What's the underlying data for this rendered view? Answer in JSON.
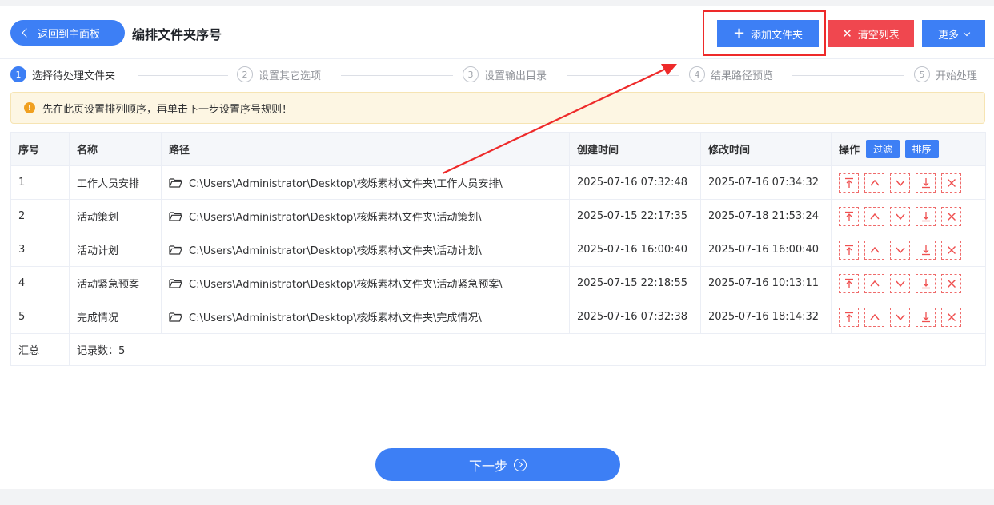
{
  "header": {
    "back_label": "返回到主面板",
    "title": "编排文件夹序号",
    "add_label": "添加文件夹",
    "clear_label": "清空列表",
    "more_label": "更多"
  },
  "steps": [
    {
      "num": "1",
      "label": "选择待处理文件夹"
    },
    {
      "num": "2",
      "label": "设置其它选项"
    },
    {
      "num": "3",
      "label": "设置输出目录"
    },
    {
      "num": "4",
      "label": "结果路径预览"
    },
    {
      "num": "5",
      "label": "开始处理"
    }
  ],
  "notice": "先在此页设置排列顺序，再单击下一步设置序号规则！",
  "table": {
    "headers": {
      "index": "序号",
      "name": "名称",
      "path": "路径",
      "created": "创建时间",
      "modified": "修改时间",
      "ops": "操作",
      "filter": "过滤",
      "sort": "排序"
    },
    "rows": [
      {
        "index": "1",
        "name": "工作人员安排",
        "path": "C:\\Users\\Administrator\\Desktop\\核烁素材\\文件夹\\工作人员安排\\",
        "created": "2025-07-16 07:32:48",
        "modified": "2025-07-16 07:34:32"
      },
      {
        "index": "2",
        "name": "活动策划",
        "path": "C:\\Users\\Administrator\\Desktop\\核烁素材\\文件夹\\活动策划\\",
        "created": "2025-07-15 22:17:35",
        "modified": "2025-07-18 21:53:24"
      },
      {
        "index": "3",
        "name": "活动计划",
        "path": "C:\\Users\\Administrator\\Desktop\\核烁素材\\文件夹\\活动计划\\",
        "created": "2025-07-16 16:00:40",
        "modified": "2025-07-16 16:00:40"
      },
      {
        "index": "4",
        "name": "活动紧急预案",
        "path": "C:\\Users\\Administrator\\Desktop\\核烁素材\\文件夹\\活动紧急预案\\",
        "created": "2025-07-15 22:18:55",
        "modified": "2025-07-16 10:13:11"
      },
      {
        "index": "5",
        "name": "完成情况",
        "path": "C:\\Users\\Administrator\\Desktop\\核烁素材\\文件夹\\完成情况\\",
        "created": "2025-07-16 07:32:38",
        "modified": "2025-07-16 18:14:32"
      }
    ],
    "summary_label": "汇总",
    "summary_value": "记录数：5"
  },
  "next_label": "下一步",
  "colors": {
    "primary": "#3d7ff5",
    "danger": "#f0474f",
    "highlight": "#ee2a2a",
    "warning": "#f0a020"
  }
}
